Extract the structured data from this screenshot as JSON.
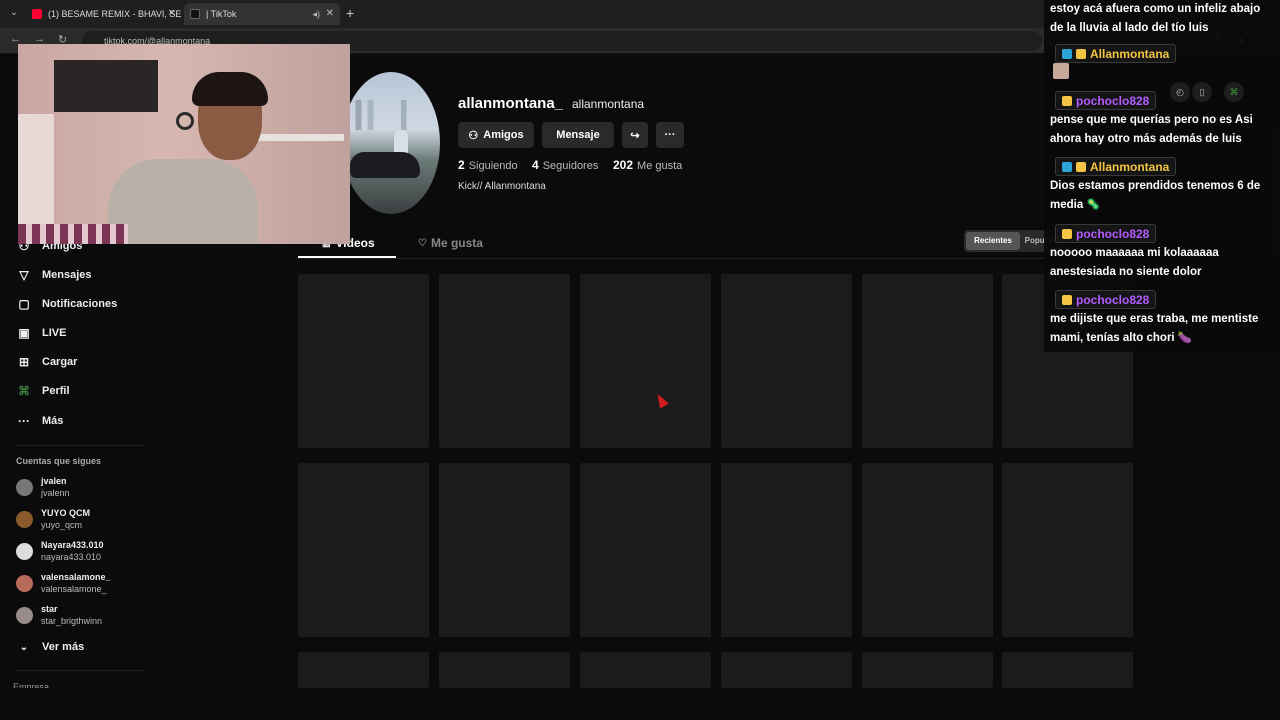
{
  "browser": {
    "tabs": [
      {
        "title": "(1) BESAME REMIX - BHAVI, SE",
        "favicon_color": "#ff0033"
      },
      {
        "title": "| TikTok",
        "favicon_color": "#111111"
      }
    ],
    "url": "tiktok.com/@allanmontana"
  },
  "sidebar": {
    "nav": [
      {
        "label": "Amigos",
        "icon": "friends-icon"
      },
      {
        "label": "Mensajes",
        "icon": "messages-icon"
      },
      {
        "label": "Notificaciones",
        "icon": "notifications-icon"
      },
      {
        "label": "LIVE",
        "icon": "live-icon"
      },
      {
        "label": "Cargar",
        "icon": "upload-icon"
      },
      {
        "label": "Perfil",
        "icon": "profile-icon"
      },
      {
        "label": "Más",
        "icon": "more-icon"
      }
    ],
    "following_title": "Cuentas que sigues",
    "following": [
      {
        "name": "jvalen",
        "handle": "jvalenn",
        "color": "#777777"
      },
      {
        "name": "YUYO QCM",
        "handle": "yuyo_qcm",
        "color": "#8a5a2a"
      },
      {
        "name": "Nayara433.010",
        "handle": "nayara433.010",
        "color": "#dddddd"
      },
      {
        "name": "valensalamone_",
        "handle": "valensalamone_",
        "color": "#b86b5a"
      },
      {
        "name": "star",
        "handle": "star_brigthwinn",
        "color": "#9a8c8c"
      }
    ],
    "see_more": "Ver más",
    "footer_cut": "Empresa"
  },
  "profile": {
    "username": "allanmontana_",
    "nickname": "allanmontana",
    "buttons": {
      "friends": "Amigos",
      "message": "Mensaje"
    },
    "stats": [
      {
        "value": "2",
        "label": "Siguiendo"
      },
      {
        "value": "4",
        "label": "Seguidores"
      },
      {
        "value": "202",
        "label": "Me gusta"
      }
    ],
    "bio": "Kick// Allanmontana",
    "tabs": {
      "videos": "Videos",
      "likes": "Me gusta"
    },
    "sort": {
      "recent": "Recientes",
      "popular": "Populares"
    }
  },
  "chat": {
    "messages": [
      {
        "user": "",
        "text": "estoy acá afuera como un infeliz abajo de la lluvia al lado del tío luis"
      },
      {
        "user": "Allanmontana",
        "user_color": "#f4c542",
        "text": ""
      },
      {
        "user": "pochoclo828",
        "user_color": "#b45cff",
        "text": "pense que me querías pero no es Asi ahora hay otro más además de luis"
      },
      {
        "user": "Allanmontana",
        "user_color": "#f4c542",
        "text": "Dios estamos prendidos tenemos 6 de media 🦠"
      },
      {
        "user": "pochoclo828",
        "user_color": "#b45cff",
        "text": "nooooo maaaaaa mi kolaaaaaa anestesiada no siente dolor"
      },
      {
        "user": "pochoclo828",
        "user_color": "#b45cff",
        "text": "me dijiste que eras traba, me mentiste mami, tenías alto chori 🍆"
      }
    ]
  }
}
